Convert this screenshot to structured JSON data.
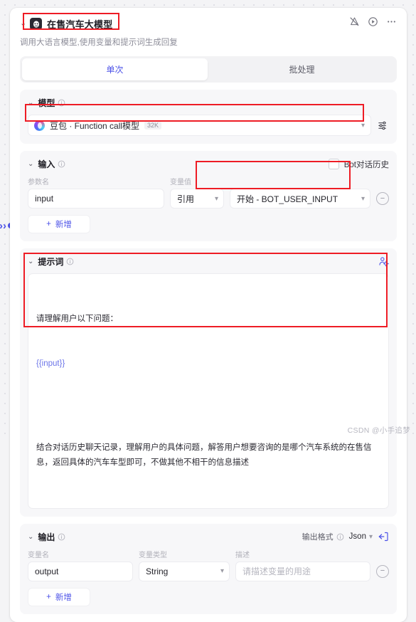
{
  "node": {
    "title": "在售汽车大模型",
    "description": "调用大语言模型,使用变量和提示词生成回复",
    "avatar_icon": "robot-face-icon",
    "collapse_caret": "⌄",
    "header_icons": [
      "alert-off-icon",
      "run-icon",
      "more-icon"
    ]
  },
  "tabs": [
    {
      "label": "单次",
      "active": true
    },
    {
      "label": "批处理",
      "active": false
    }
  ],
  "model_section": {
    "title": "模型",
    "info_icon": "info-icon",
    "caret": "⌄",
    "model_name": "豆包 · Function call模型",
    "context_badge": "32K",
    "model_logo_icon": "doubao-logo-icon",
    "dropdown_icon": "chevron-down-icon",
    "settings_icon": "model-settings-icon"
  },
  "input_section": {
    "title": "输入",
    "info_icon": "info-icon",
    "caret": "⌄",
    "bot_history": {
      "label": "Bot对话历史",
      "checked": false
    },
    "columns": [
      "参数名",
      "变量值"
    ],
    "rows": [
      {
        "param_name": "input",
        "value_type": "引用",
        "value_ref": "开始 - BOT_USER_INPUT"
      }
    ],
    "add_label": "新增",
    "add_icon": "plus-icon",
    "remove_icon": "minus-circle-icon"
  },
  "prompt_section": {
    "title": "提示词",
    "info_icon": "info-icon",
    "caret": "⌄",
    "persona_icon": "user-settings-icon",
    "line1": "请理解用户以下问题：",
    "variable": "{{input}}",
    "body": "结合对话历史聊天记录，理解用户的具体问题，解答用户想要咨询的是哪个汽车系统的在售信息，返回具体的汽车车型即可，不做其他不相干的信息描述"
  },
  "output_section": {
    "title": "输出",
    "info_icon": "info-icon",
    "caret": "⌄",
    "format_label": "输出格式",
    "format_info_icon": "info-icon",
    "format_value": "Json",
    "format_dropdown_icon": "chevron-down-icon",
    "import_icon": "import-json-icon",
    "columns": [
      "变量名",
      "变量类型",
      "描述"
    ],
    "rows": [
      {
        "var_name": "output",
        "var_type": "String",
        "desc_placeholder": "请描述变量的用途"
      }
    ],
    "add_label": "新增",
    "add_icon": "plus-icon",
    "remove_icon": "minus-circle-icon"
  },
  "watermark": "CSDN @小手追梦",
  "colors": {
    "accent": "#4d53e8",
    "highlight": "#ee1c25",
    "canvas": "#f4f4f6",
    "panel": "#f7f7f9"
  }
}
